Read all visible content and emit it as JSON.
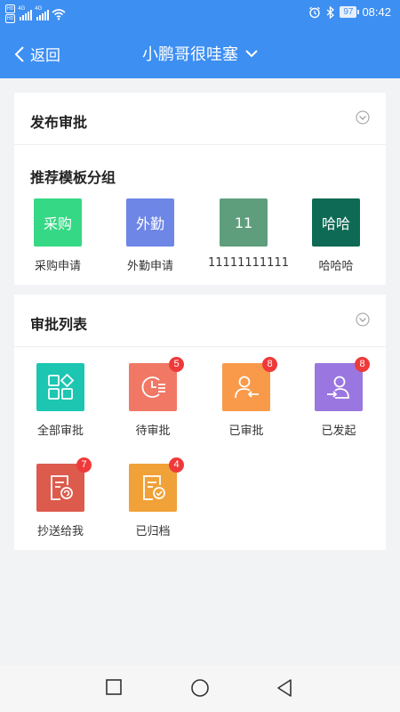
{
  "status_bar": {
    "network": [
      "4G",
      "4G"
    ],
    "hd_labels": [
      "HD",
      "HD"
    ],
    "battery": "97",
    "time": "08:42"
  },
  "nav": {
    "back_label": "返回",
    "title": "小鹏哥很哇塞"
  },
  "publish_section": {
    "title": "发布审批",
    "group_title": "推荐模板分组",
    "templates": [
      {
        "icon_text": "采购",
        "label": "采购申请",
        "color": "#35d884"
      },
      {
        "icon_text": "外勤",
        "label": "外勤申请",
        "color": "#6e86e6"
      },
      {
        "icon_text": "11",
        "label": "11111111111",
        "color": "#5f9e7c"
      },
      {
        "icon_text": "哈哈",
        "label": "哈哈哈",
        "color": "#0e6a54"
      }
    ]
  },
  "approval_section": {
    "title": "审批列表",
    "items": [
      {
        "icon": "apps-grid-icon",
        "label": "全部审批",
        "color": "#1cc6b1",
        "badge": ""
      },
      {
        "icon": "clock-list-icon",
        "label": "待审批",
        "color": "#f07865",
        "badge": "5"
      },
      {
        "icon": "user-return-icon",
        "label": "已审批",
        "color": "#f89a4a",
        "badge": "8"
      },
      {
        "icon": "user-send-icon",
        "label": "已发起",
        "color": "#9a77e0",
        "badge": "8"
      },
      {
        "icon": "doc-cc-icon",
        "label": "抄送给我",
        "color": "#dc5b4c",
        "badge": "7"
      },
      {
        "icon": "doc-check-icon",
        "label": "已归档",
        "color": "#f0a138",
        "badge": "4"
      }
    ]
  },
  "colors": {
    "primary": "#3d8ff2",
    "badge": "#ee3a3a",
    "background": "#f2f3f5"
  }
}
